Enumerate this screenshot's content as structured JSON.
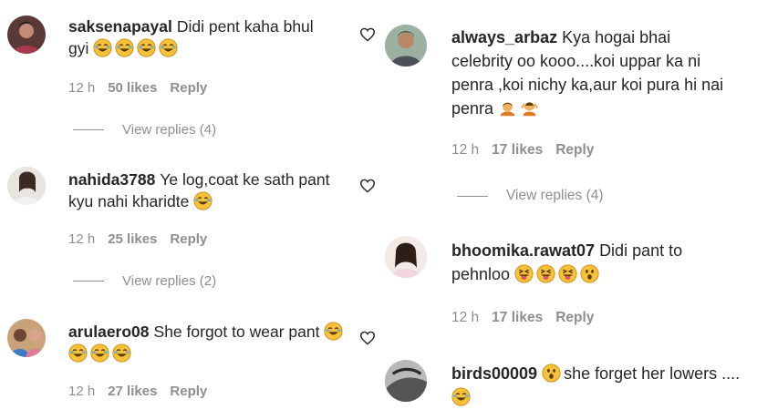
{
  "comments": [
    {
      "username": "saksenapayal",
      "text": "Didi pent kaha bhul gyi",
      "time": "12 h",
      "likes": "50 likes",
      "reply": "Reply",
      "view_replies": "View replies (4)",
      "emojis": [
        "joy",
        "joy",
        "joy",
        "joy"
      ]
    },
    {
      "username": "nahida3788",
      "text": "Ye log,coat ke sath pant kyu nahi kharidte",
      "time": "12 h",
      "likes": "25 likes",
      "reply": "Reply",
      "view_replies": "View replies (2)",
      "emojis": [
        "joy"
      ]
    },
    {
      "username": "arulaero08",
      "text": "She forgot to wear pant",
      "time": "12 h",
      "likes": "27 likes",
      "reply": "Reply",
      "emojis": [
        "joy",
        "joy",
        "joy",
        "joy"
      ]
    },
    {
      "username": "always_arbaz",
      "text": "Kya hogai bhai celebrity oo kooo....koi uppar ka ni penra ,koi nichy ka,aur koi pura hi nai penra",
      "time": "12 h",
      "likes": "17 likes",
      "reply": "Reply",
      "view_replies": "View replies (4)",
      "emojis": [
        "person-bowing",
        "person-shrugging"
      ]
    },
    {
      "username": "bhoomika.rawat07",
      "text": "Didi pant to pehnloo",
      "time": "12 h",
      "likes": "17 likes",
      "reply": "Reply",
      "emojis": [
        "squint-tongue",
        "squint-tongue",
        "squint-tongue",
        "astonished"
      ]
    },
    {
      "username": "birds00009",
      "text_before": "she forget her lowers ....",
      "emojis_inline": [
        "astonished"
      ],
      "emojis": [
        "joy"
      ]
    }
  ],
  "colors": {
    "text": "#262626",
    "secondary": "#8e8e8e",
    "emoji": "#f7c13a"
  }
}
